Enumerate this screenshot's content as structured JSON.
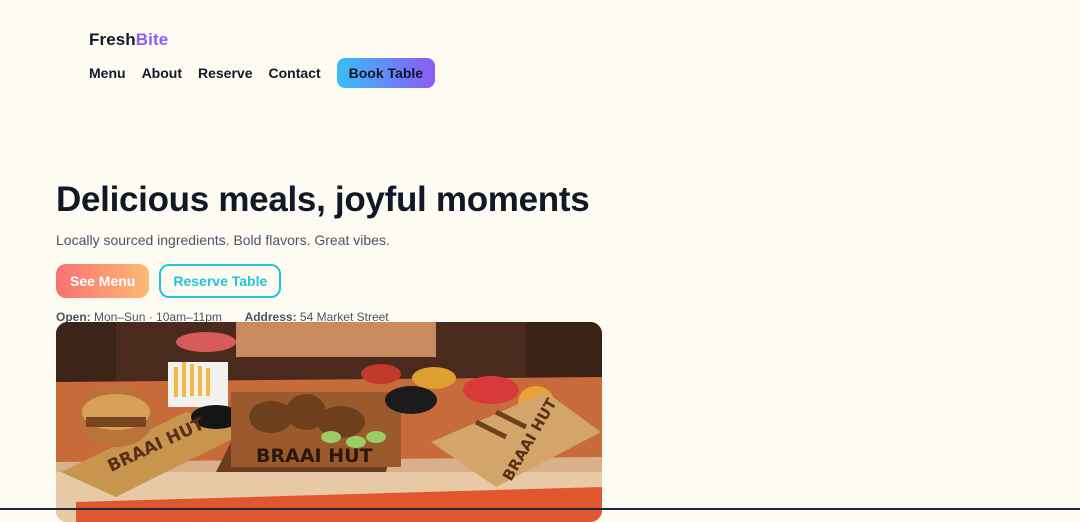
{
  "brand": {
    "part1": "Fresh",
    "part2": "Bite"
  },
  "nav": {
    "items": [
      "Menu",
      "About",
      "Reserve",
      "Contact"
    ],
    "cta": "Book Table"
  },
  "hero": {
    "title": "Delicious meals, joyful moments",
    "subtitle": "Locally sourced ingredients. Bold flavors. Great vibes.",
    "primary_button": "See Menu",
    "secondary_button": "Reserve Table",
    "open_label": "Open:",
    "open_value": "Mon–Sun · 10am–11pm",
    "address_label": "Address:",
    "address_value": "54 Market Street"
  },
  "photo": {
    "board_text": "BRAAI HUT"
  },
  "colors": {
    "background": "#fefbf3",
    "brand_accent": "#8b5cf6",
    "primary_gradient": [
      "#f87171",
      "#fdba74"
    ],
    "outline": "#22c5d5",
    "cta_gradient": [
      "#38bdf8",
      "#8b5cf6"
    ]
  }
}
